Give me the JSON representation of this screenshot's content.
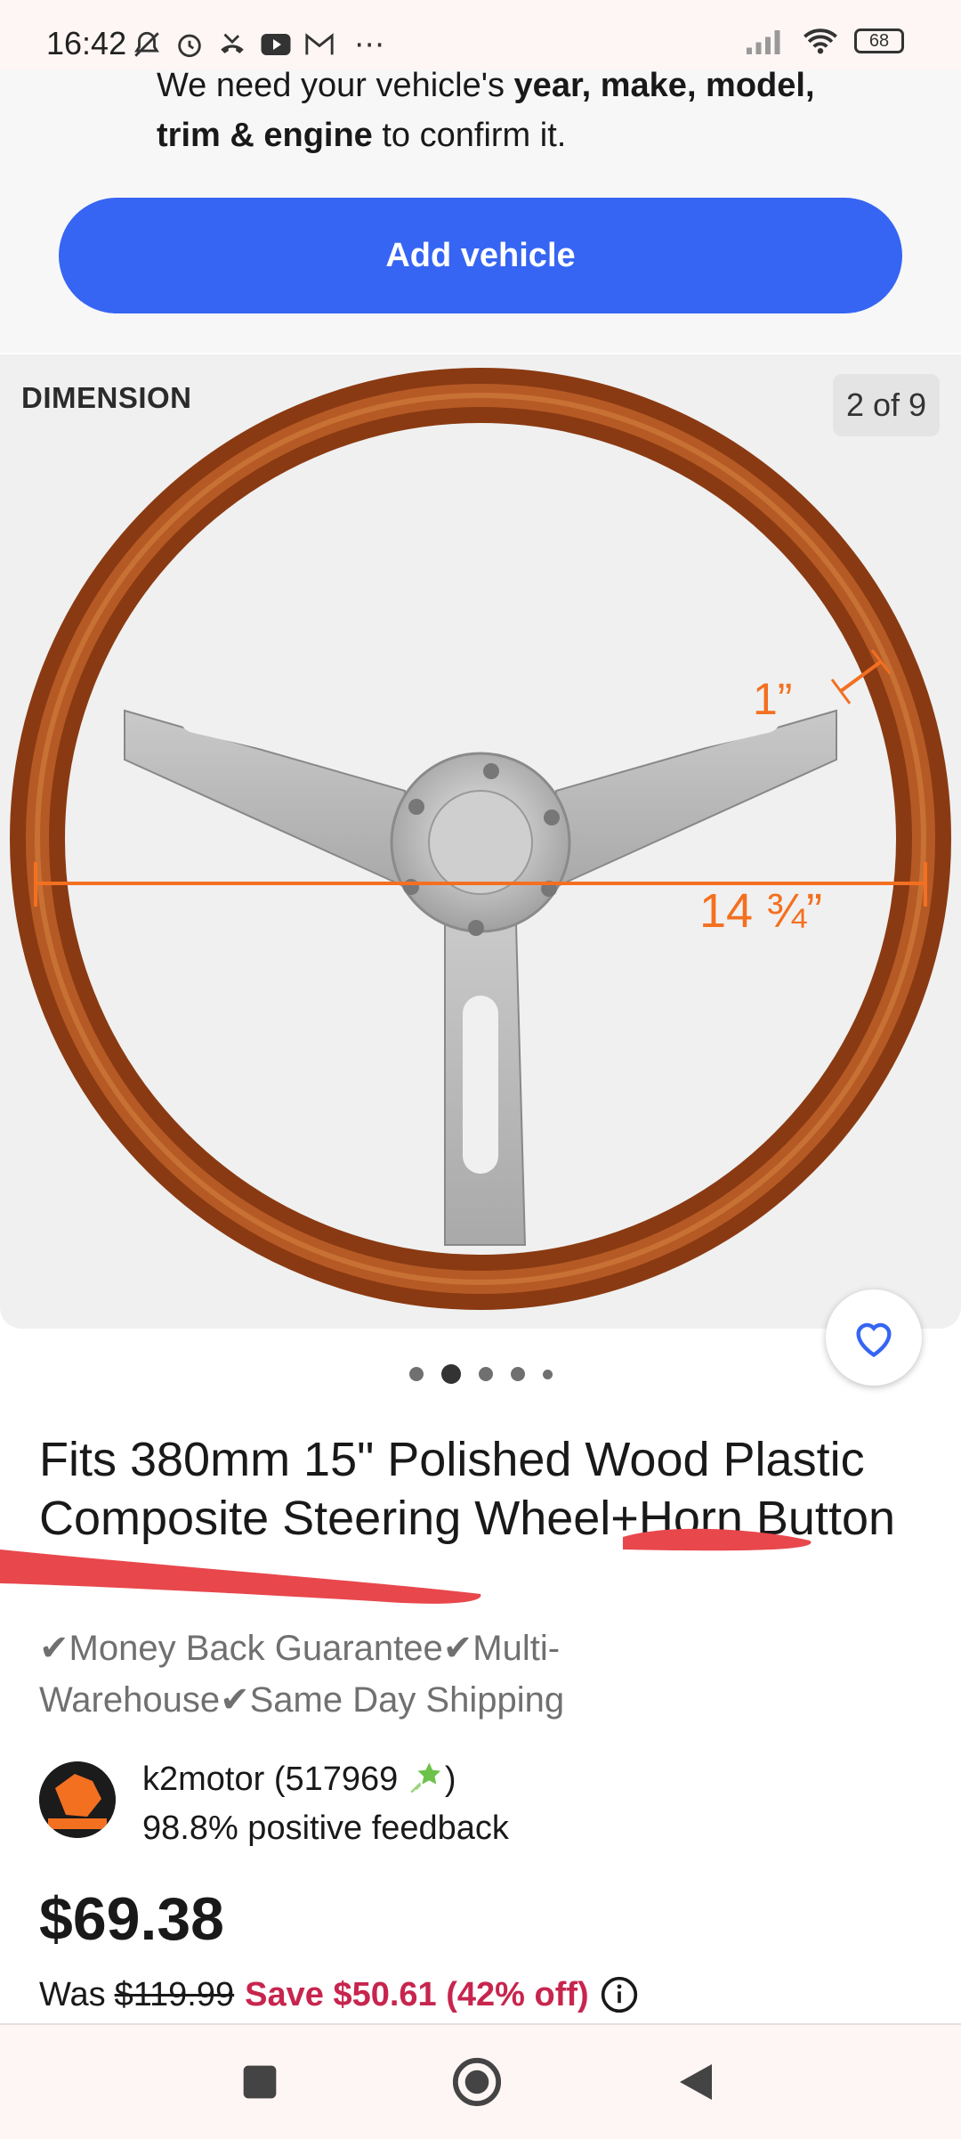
{
  "status_bar": {
    "time": "16:42",
    "battery": "68",
    "more_icon": "⋯"
  },
  "vehicle_prompt": {
    "text_prefix": "We need your vehicle's ",
    "text_bold_1": "year, make, model,",
    "text_bold_2": "trim & engine",
    "text_suffix": " to confirm it.",
    "add_vehicle_label": "Add vehicle",
    "button_color": "#3665f3"
  },
  "gallery": {
    "image_label": "DIMENSION",
    "counter": "2 of 9",
    "rim_width_label": "1”",
    "diameter_label": "14 ¾”",
    "wood_color": "#9c4417",
    "dimension_color": "#f37021",
    "page_dots": 5,
    "active_dot": 2
  },
  "product": {
    "title": "Fits 380mm 15\" Polished Wood Plastic Composite Steering Wheel+Horn Button",
    "guarantee": "✔Money Back Guarantee✔Multi-Warehouse✔Same Day Shipping",
    "seller_name": "k2motor (517969",
    "seller_name_suffix": ")",
    "seller_feedback": "98.8% positive feedback",
    "price": "$69.38",
    "was_label": "Was",
    "was_price": "$119.99",
    "save_text": "Save $50.61 (42% off)",
    "save_color": "#c7254e"
  }
}
